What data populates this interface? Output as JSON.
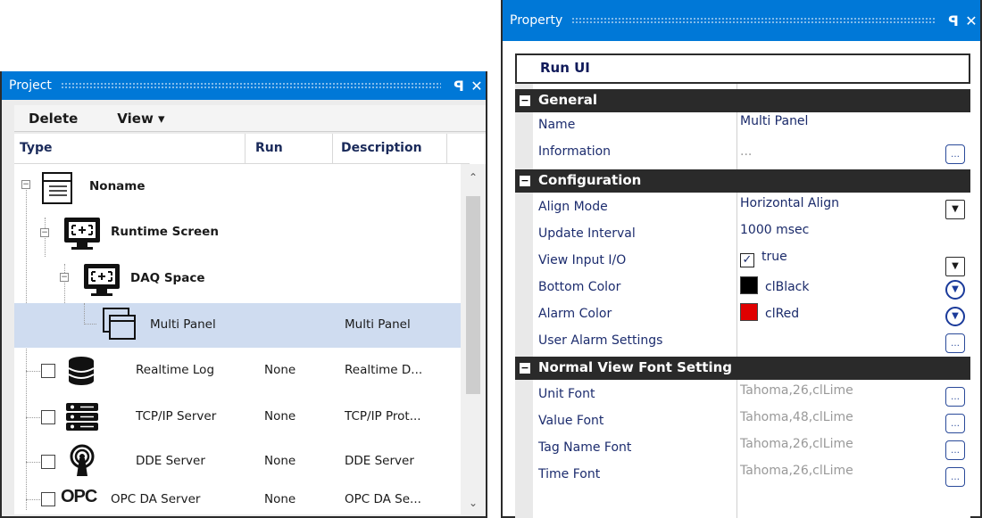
{
  "project": {
    "title": "Project",
    "toolbar": {
      "delete": "Delete",
      "view": "View ▾"
    },
    "columns": {
      "type": "Type",
      "run": "Run",
      "description": "Description"
    },
    "tree": [
      {
        "name": "Noname",
        "run": "",
        "description": ""
      },
      {
        "name": "Runtime Screen",
        "run": "",
        "description": ""
      },
      {
        "name": "DAQ Space",
        "run": "",
        "description": ""
      },
      {
        "name": "Multi Panel",
        "run": "",
        "description": "Multi Panel"
      },
      {
        "name": "Realtime Log",
        "run": "None",
        "description": "Realtime D..."
      },
      {
        "name": "TCP/IP Server",
        "run": "None",
        "description": "TCP/IP Prot..."
      },
      {
        "name": "DDE Server",
        "run": "None",
        "description": "DDE Server"
      },
      {
        "name": "OPC DA Server",
        "run": "None",
        "description": "OPC DA Se...",
        "logo": "OPC"
      }
    ]
  },
  "property": {
    "title": "Property",
    "object": "Run UI",
    "general": {
      "label": "General",
      "name_key": "Name",
      "name_val": "Multi Panel",
      "info_key": "Information",
      "info_val": "..."
    },
    "configuration": {
      "label": "Configuration",
      "align_key": "Align Mode",
      "align_val": "Horizontal Align",
      "update_key": "Update Interval",
      "update_val": "1000 msec",
      "viewio_key": "View Input I/O",
      "viewio_val": "true",
      "bottom_key": "Bottom Color",
      "bottom_val": "clBlack",
      "alarm_key": "Alarm Color",
      "alarm_val": "clRed",
      "useralarm_key": "User Alarm Settings"
    },
    "font": {
      "label": "Normal View Font Setting",
      "unit_key": "Unit Font",
      "unit_val": "Tahoma,26,clLime",
      "value_key": "Value Font",
      "value_val": "Tahoma,48,clLime",
      "tag_key": "Tag Name Font",
      "tag_val": "Tahoma,26,clLime",
      "time_key": "Time Font",
      "time_val": "Tahoma,26,clLime"
    }
  },
  "colors": {
    "titlebar": "#0078d7",
    "black": "#000000",
    "red": "#e00000"
  }
}
